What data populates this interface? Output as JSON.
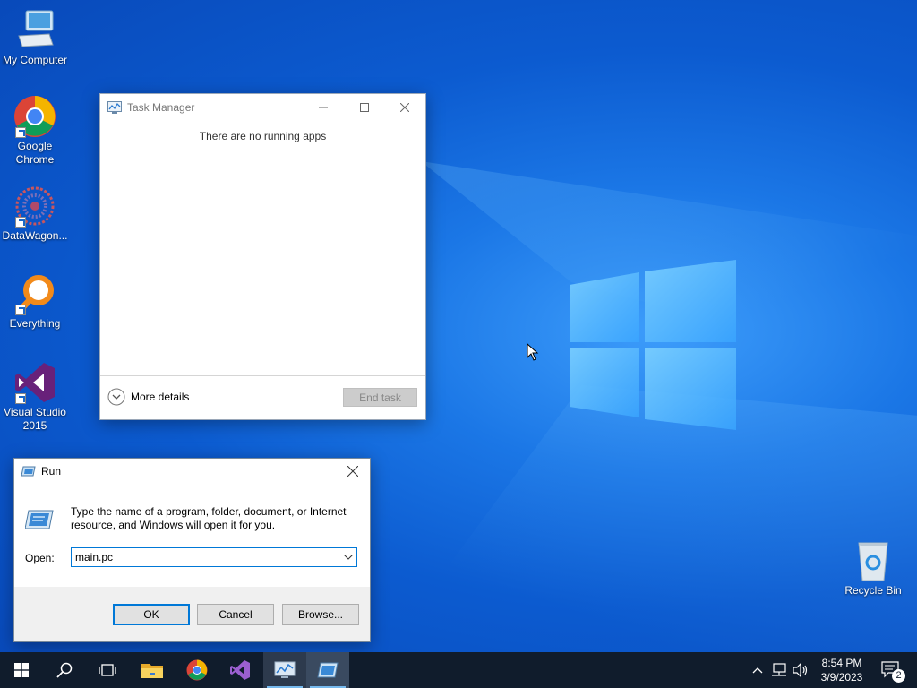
{
  "desktop": {
    "icons": [
      {
        "label": "My Computer"
      },
      {
        "label": "Google Chrome"
      },
      {
        "label": "DataWagon..."
      },
      {
        "label": "Everything"
      },
      {
        "label": "Visual Studio 2015"
      },
      {
        "label": "Recycle Bin"
      }
    ]
  },
  "task_manager": {
    "title": "Task Manager",
    "message": "There are no running apps",
    "more_details": "More details",
    "end_task": "End task"
  },
  "run_dialog": {
    "title": "Run",
    "description": "Type the name of a program, folder, document, or Internet resource, and Windows will open it for you.",
    "open_label": "Open:",
    "open_value": "main.pc",
    "ok": "OK",
    "cancel": "Cancel",
    "browse": "Browse..."
  },
  "taskbar": {
    "time": "8:54 PM",
    "date": "3/9/2023",
    "notification_count": "2"
  },
  "colors": {
    "accent": "#0078d7",
    "taskbar": "#101c2c"
  }
}
